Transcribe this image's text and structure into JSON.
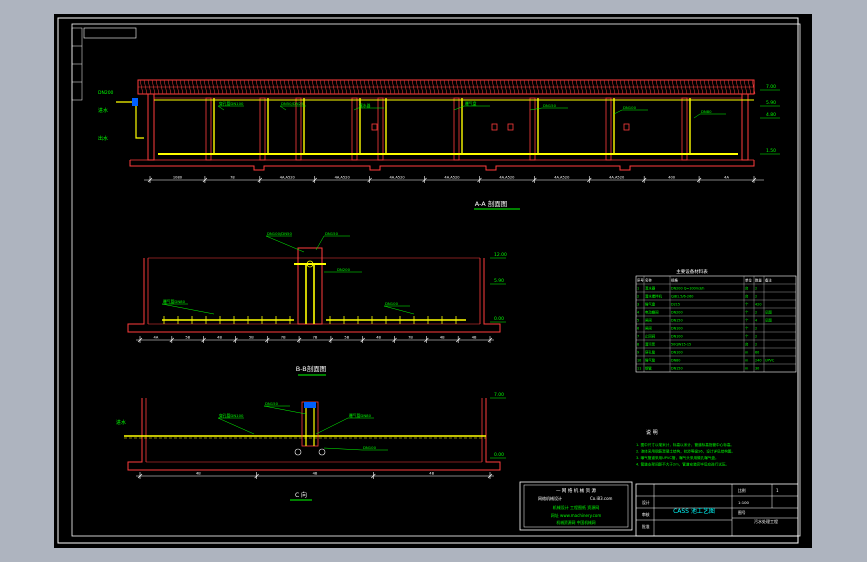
{
  "drawing_title": "CASS 池工艺图",
  "views": {
    "aa": {
      "label": "A-A 剖面图"
    },
    "bb": {
      "label": "B-B剖面图"
    },
    "c": {
      "label": "C 向"
    }
  },
  "dims": {
    "aa_bottom": [
      "1080",
      "78",
      "4A.A520",
      "4A.A520",
      "4A.A520",
      "4A.A520",
      "4A.A520",
      "4A.A520",
      "4A.A520",
      "400",
      "4A"
    ],
    "bb_bottom": [
      "4A",
      "5B",
      "4B",
      "5B",
      "7B",
      "7B",
      "5B",
      "4B",
      "7B",
      "4B",
      "4B"
    ],
    "c_bottom": [
      "4B",
      "4B",
      "4B"
    ]
  },
  "levels": {
    "l1": "7.00",
    "l2": "5.90",
    "l3": "4.80",
    "l4": "1.50",
    "l5": "12.00",
    "l6": "0.00"
  },
  "side_labels": {
    "water_in": "进水",
    "water_out": "出水",
    "pipe1": "DN200"
  },
  "callouts": {
    "aa": [
      "穿孔管DN100",
      "DN50/DN25",
      "滗水器",
      "曝气盘",
      "DN150",
      "DN100",
      "DN80"
    ],
    "bb": [
      "DN100/DN50",
      "DN150",
      "曝气管DN80",
      "DN200",
      "DN100"
    ],
    "c": [
      "穿孔管DN100",
      "DN150",
      "曝气管DN80",
      "DN100"
    ]
  },
  "material_table": {
    "title": "主要设备材料表",
    "headers": [
      "序号",
      "名称",
      "规格",
      "单位",
      "数量",
      "备注"
    ],
    "rows": [
      [
        "1",
        "滗水器",
        "DN200 Q=100m3/h",
        "台",
        "2",
        ""
      ],
      [
        "2",
        "潜水搅拌机",
        "QJB1.5/6-260",
        "台",
        "2",
        ""
      ],
      [
        "3",
        "曝气盘",
        "D215",
        "个",
        "420",
        ""
      ],
      [
        "4",
        "电动蝶阀",
        "DN200",
        "个",
        "2",
        "见图"
      ],
      [
        "5",
        "闸阀",
        "DN150",
        "个",
        "4",
        "见图"
      ],
      [
        "6",
        "闸阀",
        "DN100",
        "个",
        "2",
        ""
      ],
      [
        "7",
        "止回阀",
        "DN100",
        "个",
        "2",
        ""
      ],
      [
        "8",
        "潜污泵",
        "50QW15-15",
        "台",
        "2",
        ""
      ],
      [
        "9",
        "穿孔管",
        "DN100",
        "m",
        "60",
        ""
      ],
      [
        "10",
        "曝气管",
        "DN80",
        "m",
        "240",
        "UPVC"
      ],
      [
        "11",
        "钢管",
        "DN150",
        "m",
        "30",
        ""
      ]
    ]
  },
  "notes": {
    "title": "说 明",
    "lines": [
      "1. 图中尺寸以毫米计，标高以米计，管道标高指管中心标高。",
      "2. 池体采用钢筋混凝土结构，抗渗等级S6，设计详见结构图。",
      "3. 曝气管道采用UPVC管，曝气头采用微孔曝气盘。",
      "4. 管道支架间距不大于2m，管道安装完毕后应进行试压。"
    ]
  },
  "stamp": {
    "line1": "一 网 络 机 械 资 源",
    "line2": "网络机械设计",
    "line3": "Co.i83.com",
    "line4": "机械设计 工程图纸 资源网",
    "line5": "网址 www.machinery.com",
    "line6": "机械资源网 中国机械网"
  },
  "title_block": {
    "project": "CASS 池工艺图",
    "scale_label": "比例",
    "scale": "1:100",
    "sheet_label": "图号",
    "sheet_no": "1",
    "designer": "设计",
    "checker": "审核",
    "approver": "批准",
    "company": "污水处理工程"
  },
  "colors": {
    "background": "#000000",
    "outer": "#aeb4bf",
    "frame": "#ffffff",
    "structure": "#ff3c3c",
    "pipe": "#ffff00",
    "annotation": "#00ff00",
    "dimension": "#ffffff",
    "title": "#00ffff",
    "accent": "#ff00ff"
  }
}
